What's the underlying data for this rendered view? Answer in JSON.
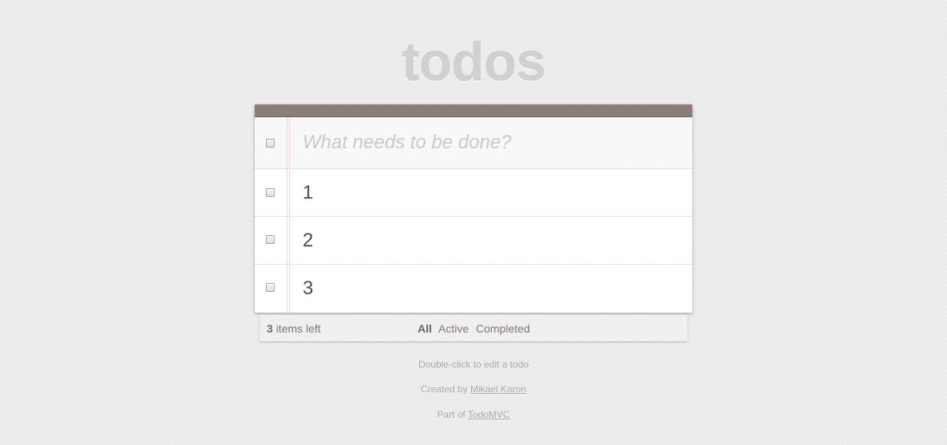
{
  "app": {
    "title": "todos"
  },
  "new_todo": {
    "placeholder": "What needs to be done?",
    "value": ""
  },
  "todos": [
    {
      "title": "1",
      "completed": false
    },
    {
      "title": "2",
      "completed": false
    },
    {
      "title": "3",
      "completed": false
    }
  ],
  "footer": {
    "count": "3",
    "count_suffix": "items left",
    "filters": {
      "all": "All",
      "active": "Active",
      "completed": "Completed",
      "selected": "All"
    }
  },
  "info": {
    "hint": "Double-click to edit a todo",
    "created_prefix": "Created by",
    "author": "Mikael Karon",
    "part_prefix": "Part of",
    "project": "TodoMVC"
  },
  "colors": {
    "header_bar": "#8c7e77",
    "title": "#d0d0d0",
    "filter_link": "#83756f"
  },
  "icons": {
    "toggle_all": "checkbox-icon",
    "toggle_item": "checkbox-icon"
  }
}
